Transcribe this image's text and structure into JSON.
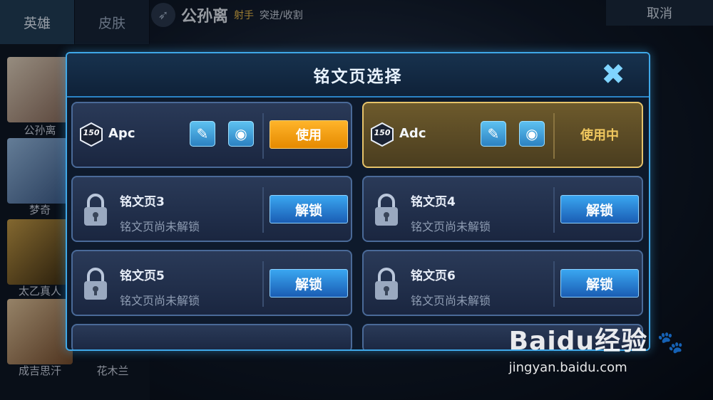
{
  "tabs": {
    "hero": "英雄",
    "skin": "皮肤"
  },
  "cancel_label": "取消",
  "selected_hero": {
    "name": "公孙离",
    "role": "射手",
    "specialty": "突进/收割"
  },
  "hero_list": [
    {
      "name": "公孙离"
    },
    {
      "name": "梦奇"
    },
    {
      "name": "太乙真人"
    },
    {
      "name": "成吉思汗"
    },
    {
      "name": "花木兰"
    }
  ],
  "modal": {
    "title": "铭文页选择",
    "close_icon": "close-x",
    "pages": [
      {
        "level": "150",
        "name": "Apc",
        "state": "available",
        "action": "使用",
        "edit_icon": "eraser",
        "view_icon": "eye"
      },
      {
        "level": "150",
        "name": "Adc",
        "state": "in-use",
        "action": "使用中",
        "edit_icon": "eraser",
        "view_icon": "eye"
      },
      {
        "name": "铭文页3",
        "status": "铭文页尚未解锁",
        "action": "解锁"
      },
      {
        "name": "铭文页4",
        "status": "铭文页尚未解锁",
        "action": "解锁"
      },
      {
        "name": "铭文页5",
        "status": "铭文页尚未解锁",
        "action": "解锁"
      },
      {
        "name": "铭文页6",
        "status": "铭文页尚未解锁",
        "action": "解锁"
      }
    ]
  },
  "watermark": {
    "brand": "Baidu经验",
    "url": "jingyan.baidu.com"
  },
  "colors": {
    "accent": "#3fa8e8",
    "use_orange": "#f29a10",
    "in_use_gold": "#e6c36a",
    "unlock_blue": "#2a7fd8"
  }
}
